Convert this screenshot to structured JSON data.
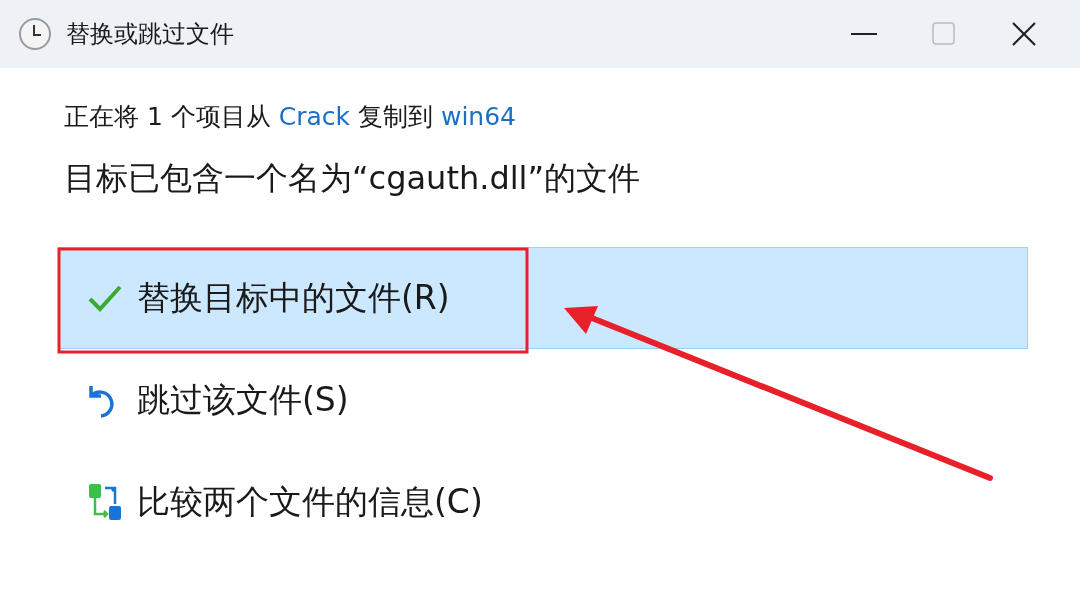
{
  "window": {
    "title": "替换或跳过文件"
  },
  "subtitle": {
    "before": "正在将 1 个项目从",
    "source": "Crack",
    "middle": "复制到",
    "destination": "win64"
  },
  "heading": "目标已包含一个名为“cgauth.dll”的文件",
  "options": [
    {
      "kind": "replace",
      "label": "替换目标中的文件(R)",
      "selected": true
    },
    {
      "kind": "skip",
      "label": "跳过该文件(S)",
      "selected": false
    },
    {
      "kind": "compare",
      "label": "比较两个文件的信息(C)",
      "selected": false
    }
  ]
}
